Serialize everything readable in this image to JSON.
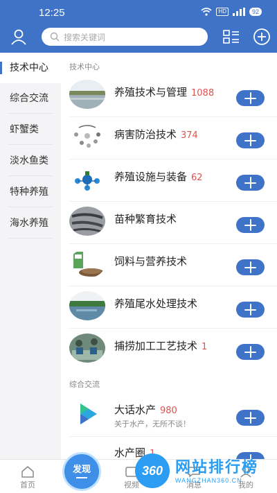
{
  "status_bar": {
    "time": "12:25",
    "hd_label": "HD",
    "battery": "92"
  },
  "header": {
    "search_placeholder": "搜索关键词"
  },
  "sidebar": {
    "items": [
      {
        "label": "技术中心",
        "active": true
      },
      {
        "label": "综合交流",
        "active": false
      },
      {
        "label": "虾蟹类",
        "active": false
      },
      {
        "label": "淡水鱼类",
        "active": false
      },
      {
        "label": "特种养殖",
        "active": false
      },
      {
        "label": "海水养殖",
        "active": false
      }
    ]
  },
  "sections": [
    {
      "title": "技术中心",
      "rows": [
        {
          "title": "养殖技术与管理",
          "count": "1088"
        },
        {
          "title": "病害防治技术",
          "count": "374"
        },
        {
          "title": "养殖设施与装备",
          "count": "62"
        },
        {
          "title": "苗种繁育技术",
          "count": ""
        },
        {
          "title": "饲料与营养技术",
          "count": ""
        },
        {
          "title": "养殖尾水处理技术",
          "count": ""
        },
        {
          "title": "捕捞加工工艺技术",
          "count": "1"
        }
      ]
    },
    {
      "title": "综合交流",
      "rows": [
        {
          "title": "大话水产",
          "count": "980",
          "subtitle": "关于水产，无所不谈！"
        },
        {
          "title": "水产圈",
          "count": "1"
        }
      ]
    }
  ],
  "tabbar": {
    "tabs": [
      {
        "label": "首页"
      },
      {
        "label": "发现"
      },
      {
        "label": "视频"
      },
      {
        "label": "消息"
      },
      {
        "label": "我的"
      }
    ]
  },
  "watermark": {
    "badge": "360",
    "brand": "网站排行榜",
    "url": "WANGZHAN360.CN"
  },
  "colors": {
    "primary": "#3f73c8",
    "count_red": "#e0524f",
    "sidebar_bg": "#f4f4f6"
  }
}
